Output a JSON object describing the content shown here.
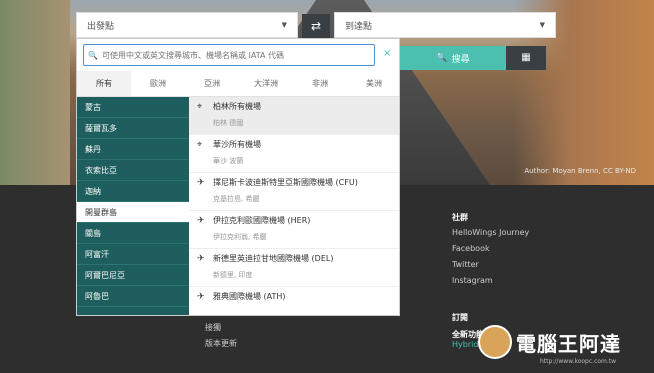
{
  "search": {
    "from_placeholder": "出發點",
    "to_placeholder": "到達點",
    "swap_icon": "⇄",
    "search_label": "搜尋",
    "search_icon": "🔍",
    "calendar_icon": "▦"
  },
  "hero": {
    "credit": "Author: Moyan Brenn, CC BY-ND"
  },
  "dropdown": {
    "input_placeholder": "可使用中文或英文搜尋城市、機場名稱或 IATA 代碼",
    "close": "×",
    "tabs": [
      "所有",
      "歐洲",
      "亞洲",
      "大洋洲",
      "非洲",
      "美洲"
    ],
    "regions": [
      "蒙古",
      "薩爾瓦多",
      "蘇丹",
      "衣索比亞",
      "迦納",
      "開曼群島",
      "關島",
      "阿富汗",
      "阿爾巴尼亞",
      "阿魯巴"
    ],
    "selected_region_index": 5,
    "airports": [
      {
        "icon": "pin-icon",
        "name": "柏林所有機場",
        "sub": "柏林 德國"
      },
      {
        "icon": "pin-icon",
        "name": "華沙所有機場",
        "sub": "華沙 波蘭"
      },
      {
        "icon": "plane-icon",
        "name": "擇尼斯卡波迪斯特里亞斯國際機場 (CFU)",
        "sub": "克基拉島, 希臘"
      },
      {
        "icon": "plane-icon",
        "name": "伊拉克利歐國際機場 (HER)",
        "sub": "伊拉克利翁, 希臘"
      },
      {
        "icon": "plane-icon",
        "name": "新德里英迪拉甘地國際機場 (DEL)",
        "sub": "新德里, 印度"
      },
      {
        "icon": "plane-icon",
        "name": "雅典國際機場 (ATH)",
        "sub": ""
      }
    ]
  },
  "footer": {
    "social_title": "社群",
    "social_links": [
      "HelloWings Journey",
      "Facebook",
      "Twitter",
      "Instagram"
    ],
    "subscribe_title": "訂閱",
    "subscribe_text": "全新功能...",
    "subscribe_sub": "Hybrid",
    "links": [
      "接獨",
      "版本更新"
    ]
  },
  "logo": {
    "text": "電腦王阿達",
    "url": "http://www.koopc.com.tw"
  },
  "colors": {
    "accent": "#4bbfb0",
    "region_bg": "#1f5e5e",
    "dark": "#3a3f44"
  }
}
